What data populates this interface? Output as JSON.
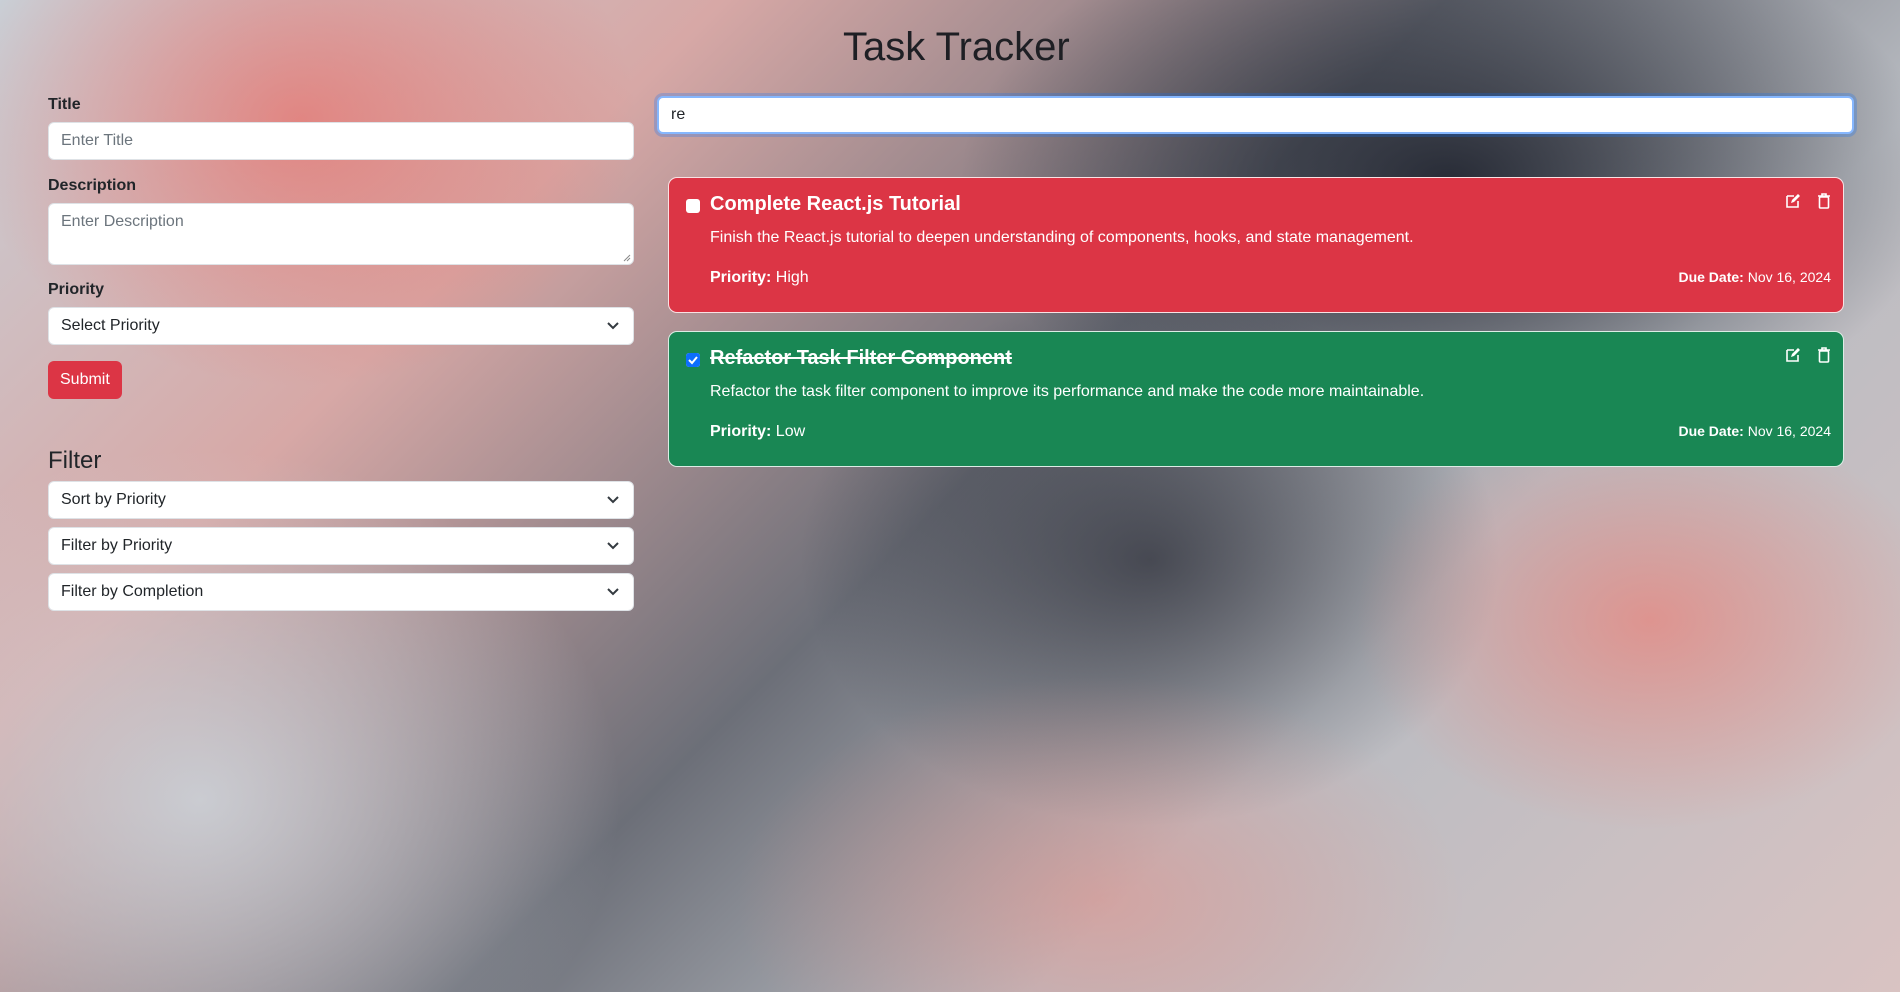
{
  "header": {
    "title": "Task Tracker"
  },
  "form": {
    "title_label": "Title",
    "title_placeholder": "Enter Title",
    "description_label": "Description",
    "description_placeholder": "Enter Description",
    "priority_label": "Priority",
    "priority_selected": "Select Priority",
    "submit_label": "Submit"
  },
  "filter": {
    "heading": "Filter",
    "sort_selected": "Sort by Priority",
    "priority_selected": "Filter by Priority",
    "completion_selected": "Filter by Completion"
  },
  "search": {
    "value": "re"
  },
  "tasks": [
    {
      "title": "Complete React.js Tutorial",
      "description": "Finish the React.js tutorial to deepen understanding of components, hooks, and state management.",
      "priority_label": "Priority:",
      "priority": "High",
      "due_label": "Due Date:",
      "due": "Nov 16, 2024",
      "completed": false,
      "color": "#dc3545"
    },
    {
      "title": "Refactor Task Filter Component",
      "description": "Refactor the task filter component to improve its performance and make the code more maintainable.",
      "priority_label": "Priority:",
      "priority": "Low",
      "due_label": "Due Date:",
      "due": "Nov 16, 2024",
      "completed": true,
      "color": "#198754"
    }
  ],
  "colors": {
    "danger": "#dc3545",
    "success": "#198754",
    "focus": "#86b7fe"
  }
}
